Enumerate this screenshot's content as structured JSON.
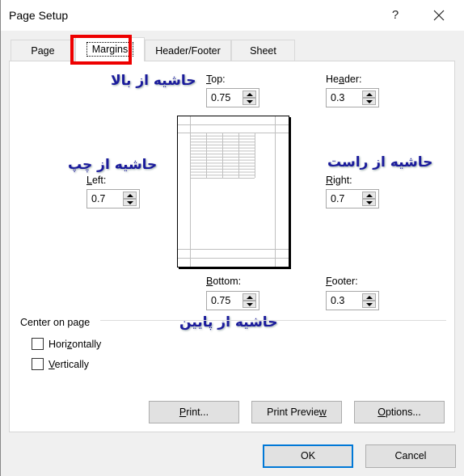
{
  "window": {
    "title": "Page Setup",
    "help_label": "?",
    "close_icon": "close-icon"
  },
  "tabs": [
    {
      "label": "Page",
      "active": false
    },
    {
      "label": "Margins",
      "active": true
    },
    {
      "label": "Header/Footer",
      "active": false
    },
    {
      "label": "Sheet",
      "active": false
    }
  ],
  "annotation": {
    "color": "#ee0000",
    "target": "Margins"
  },
  "margins": {
    "top": {
      "label_pre": "",
      "label_ul": "T",
      "label_post": "op:",
      "value": "0.75"
    },
    "header": {
      "label_pre": "He",
      "label_ul": "a",
      "label_post": "der:",
      "value": "0.3"
    },
    "left": {
      "label_pre": "",
      "label_ul": "L",
      "label_post": "eft:",
      "value": "0.7"
    },
    "right": {
      "label_pre": "",
      "label_ul": "R",
      "label_post": "ight:",
      "value": "0.7"
    },
    "bottom": {
      "label_pre": "",
      "label_ul": "B",
      "label_post": "ottom:",
      "value": "0.75"
    },
    "footer": {
      "label_pre": "",
      "label_ul": "F",
      "label_post": "ooter:",
      "value": "0.3"
    }
  },
  "persian_labels": {
    "top": "حاشیه از بالا",
    "left": "حاشیه از چپ",
    "right": "حاشیه از راست",
    "bottom": "حاشیه از پایین",
    "color": "#1b1b9c"
  },
  "center_on_page": {
    "group_label": "Center on page",
    "horizontally": {
      "label_pre": "Hori",
      "label_ul": "z",
      "label_post": "ontally",
      "checked": false
    },
    "vertically": {
      "label_pre": "",
      "label_ul": "V",
      "label_post": "ertically",
      "checked": false
    }
  },
  "panel_buttons": {
    "print": {
      "pre": "",
      "ul": "P",
      "post": "rint..."
    },
    "print_preview": {
      "pre": "Print Previe",
      "ul": "w",
      "post": ""
    },
    "options": {
      "pre": "",
      "ul": "O",
      "post": "ptions..."
    }
  },
  "footer_buttons": {
    "ok": "OK",
    "cancel": "Cancel"
  }
}
